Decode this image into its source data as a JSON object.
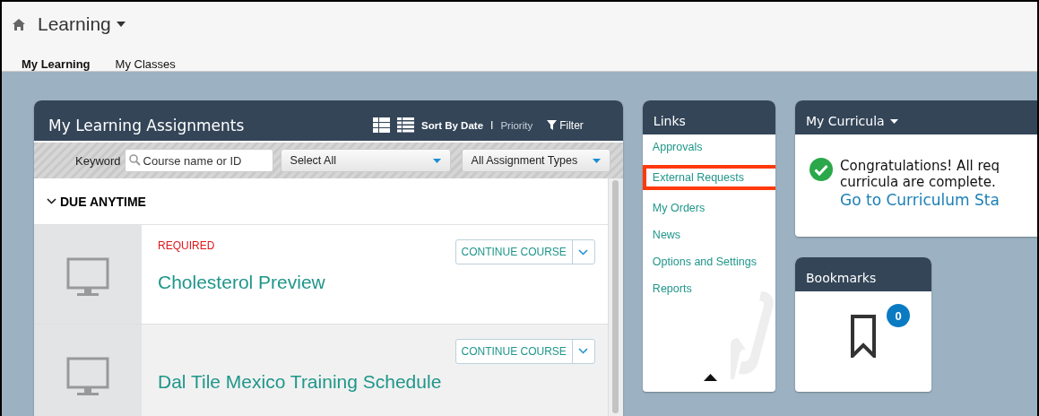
{
  "header": {
    "title": "Learning"
  },
  "tabs": [
    {
      "label": "My Learning",
      "selected": true
    },
    {
      "label": "My Classes",
      "selected": false
    }
  ],
  "assignments": {
    "title": "My Learning Assignments",
    "sort": {
      "separator": "I",
      "options": [
        {
          "label": "Sort By Date",
          "selected": true
        },
        {
          "label": "Priority",
          "selected": false
        }
      ]
    },
    "filter": "Filter",
    "keyword": {
      "label": "Keyword",
      "placeholder": "Course name or ID"
    },
    "selects": [
      "Select All",
      "All Assignment Types"
    ],
    "section": {
      "label": "DUE ANYTIME",
      "expanded": true
    },
    "rows": [
      {
        "tag": "REQUIRED",
        "title": "Cholesterol Preview",
        "button": "CONTINUE COURSE",
        "hovered": false
      },
      {
        "title": "Dal Tile Mexico Training Schedule",
        "button": "CONTINUE COURSE",
        "hovered": true
      }
    ]
  },
  "links": {
    "title": "Links",
    "items": [
      {
        "label": "Approvals",
        "highlighted": false
      },
      {
        "label": "External Requests",
        "highlighted": true
      },
      {
        "label": "My Orders",
        "highlighted": false
      },
      {
        "label": "News",
        "highlighted": false
      },
      {
        "label": "Options and Settings",
        "highlighted": false
      },
      {
        "label": "Reports",
        "highlighted": false
      }
    ]
  },
  "curricula": {
    "title": "My Curricula",
    "message": "Congratulations! All req",
    "message_2": "curricula are complete.",
    "link": "Go to Curriculum Sta"
  },
  "bookmarks": {
    "title": "Bookmarks",
    "count": "0"
  }
}
